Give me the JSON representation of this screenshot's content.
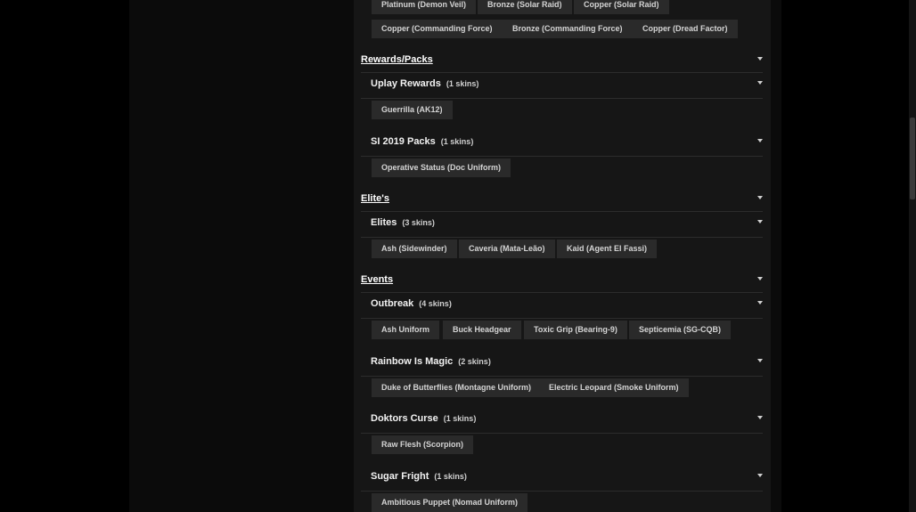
{
  "top_chips": {
    "row1": [
      "Platinum (Demon Veil)",
      "Bronze (Solar Raid)",
      "Copper (Solar Raid)"
    ],
    "row2": [
      "Copper (Commanding Force)",
      "Bronze (Commanding Force)",
      "Copper (Dread Factor)"
    ]
  },
  "sections": [
    {
      "title": "Rewards/Packs",
      "groups": [
        {
          "title": "Uplay Rewards",
          "count": "(1 skins)",
          "skins": [
            "Guerrilla (AK12)"
          ]
        },
        {
          "title": "SI 2019 Packs",
          "count": "(1 skins)",
          "skins": [
            "Operative Status (Doc Uniform)"
          ]
        }
      ]
    },
    {
      "title": "Elite's",
      "groups": [
        {
          "title": "Elites",
          "count": "(3 skins)",
          "skins": [
            "Ash (Sidewinder)",
            "Caveria (Mata-Leão)",
            "Kaid (Agent El Fassi)"
          ]
        }
      ]
    },
    {
      "title": "Events",
      "groups": [
        {
          "title": "Outbreak",
          "count": "(4 skins)",
          "skins": [
            "Ash Uniform",
            "Buck Headgear",
            "Toxic Grip (Bearing-9)",
            "Septicemia (SG-CQB)"
          ]
        },
        {
          "title": "Rainbow Is Magic",
          "count": "(2 skins)",
          "skins": [
            "Duke of Butterflies (Montagne Uniform)",
            "Electric Leopard (Smoke Uniform)"
          ]
        },
        {
          "title": "Doktors Curse",
          "count": "(1 skins)",
          "skins": [
            "Raw Flesh (Scorpion)"
          ]
        },
        {
          "title": "Sugar Fright",
          "count": "(1 skins)",
          "skins": [
            "Ambitious Puppet (Nomad Uniform)"
          ]
        }
      ]
    }
  ],
  "icons": {
    "section_toggle": "caret-down-icon"
  },
  "colors": {
    "page_background": "#000000",
    "panel_background": "#161616",
    "chip_background": "#2a2a2a",
    "divider": "#2c2c2c",
    "text": "#ffffff",
    "chip_text": "#d4d4d4"
  }
}
